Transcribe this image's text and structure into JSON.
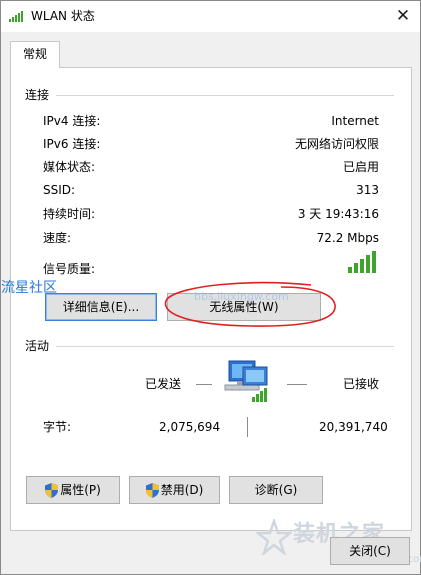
{
  "window": {
    "title": "WLAN 状态",
    "close_glyph": "✕"
  },
  "tabs": [
    {
      "label": "常规"
    }
  ],
  "connection": {
    "section_label": "连接",
    "rows": [
      {
        "label": "IPv4 连接:",
        "value": "Internet"
      },
      {
        "label": "IPv6 连接:",
        "value": "无网络访问权限"
      },
      {
        "label": "媒体状态:",
        "value": "已启用"
      },
      {
        "label": "SSID:",
        "value": "313"
      },
      {
        "label": "持续时间:",
        "value": "3 天 19:43:16"
      },
      {
        "label": "速度:",
        "value": "72.2 Mbps"
      }
    ],
    "signal_label": "信号质量:",
    "signal_bars": 5,
    "signal_color": "#3ea42c"
  },
  "buttons": {
    "details": "详细信息(E)...",
    "wireless_properties": "无线属性(W)",
    "properties": "属性(P)",
    "disable": "禁用(D)",
    "diagnose": "诊断(G)",
    "close": "关闭(C)"
  },
  "activity": {
    "section_label": "活动",
    "sent_label": "已发送",
    "received_label": "已接收",
    "bytes_label": "字节:",
    "bytes_sent": "2,075,694",
    "bytes_received": "20,391,740"
  },
  "annotation": {
    "color": "#e02020"
  },
  "watermark": {
    "left_text": "流星社区",
    "mid_text": "bbs.liuxingw.com",
    "logo_text": "装机之家",
    "logo_url": "www.lotpc.com"
  },
  "colors": {
    "accent": "#3c7fd8",
    "shield_blue": "#2f6fcf",
    "shield_yellow": "#f2c12e"
  }
}
